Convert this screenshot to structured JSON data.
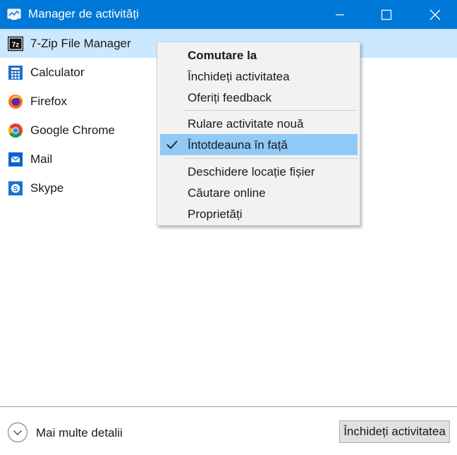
{
  "window": {
    "title": "Manager de activități",
    "accent_color": "#0078d7",
    "icon": "task-manager-icon",
    "controls": [
      "minimize-icon",
      "maximize-icon",
      "close-icon"
    ]
  },
  "apps": [
    {
      "label": "7-Zip File Manager",
      "icon": "7zip-icon",
      "selected": true
    },
    {
      "label": "Calculator",
      "icon": "calculator-icon"
    },
    {
      "label": "Firefox",
      "icon": "firefox-icon"
    },
    {
      "label": "Google Chrome",
      "icon": "chrome-icon"
    },
    {
      "label": "Mail",
      "icon": "mail-icon"
    },
    {
      "label": "Skype",
      "icon": "skype-icon"
    }
  ],
  "context_menu": {
    "items": [
      {
        "label": "Comutare la",
        "bold": true
      },
      {
        "label": "Închideți activitatea"
      },
      {
        "label": "Oferiți feedback"
      },
      {
        "label": "Rulare activitate nouă"
      },
      {
        "label": "Întotdeauna în față",
        "checked": true,
        "highlighted": true
      },
      {
        "label": "Deschidere locație fișier"
      },
      {
        "label": "Căutare online"
      },
      {
        "label": "Proprietăți"
      }
    ]
  },
  "footer": {
    "details_label": "Mai multe detalii",
    "details_icon": "chevron-down-circle-icon",
    "end_task_label": "Închideți activitatea"
  }
}
